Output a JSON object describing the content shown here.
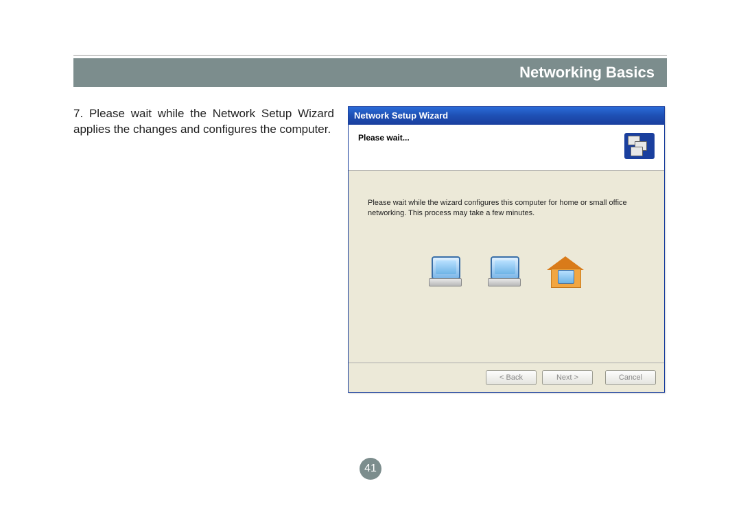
{
  "header": {
    "title": "Networking Basics"
  },
  "instruction": {
    "text": "7. Please wait while the Network Setup Wizard applies the changes and configures the computer."
  },
  "dialog": {
    "title": "Network Setup Wizard",
    "header_text": "Please wait...",
    "body_text": "Please wait while the wizard configures this computer for home or small office networking. This process may take a few minutes.",
    "buttons": {
      "back": "< Back",
      "next": "Next >",
      "cancel": "Cancel"
    }
  },
  "page_number": "41"
}
